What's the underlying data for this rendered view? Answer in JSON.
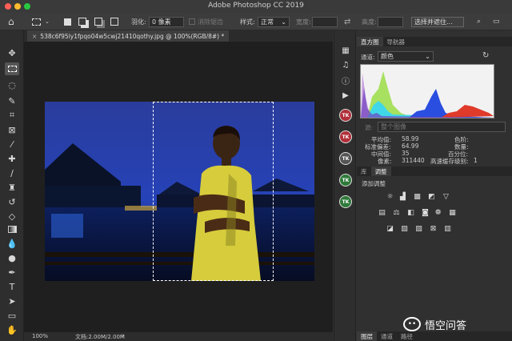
{
  "window": {
    "title": "Adobe Photoshop CC 2019"
  },
  "options_bar": {
    "feather_label": "羽化:",
    "feather_value": "0 像素",
    "antialias_label": "消除锯齿",
    "style_label": "样式:",
    "style_value": "正常",
    "width_label": "宽度:",
    "height_label": "高度:",
    "select_mask_button": "选择并遮住..."
  },
  "document": {
    "tab_title": "538c6f95ly1fpqo04w5cwj21410qothy.jpg @ 100%(RGB/8#) *",
    "zoom": "100%",
    "doc_size": "文档:2.00M/2.00M"
  },
  "histogram_panel": {
    "tabs": [
      "直方图",
      "导航器"
    ],
    "channel_label": "通道:",
    "channel_value": "颜色",
    "source_label": "源:",
    "source_value": "整个图像",
    "stats": {
      "mean_label": "平均值:",
      "mean": "58.99",
      "std_label": "标准偏差:",
      "std": "64.99",
      "median_label": "中间值:",
      "median": "35",
      "pixels_label": "像素:",
      "pixels": "311440",
      "level_label": "色阶:",
      "count_label": "数量:",
      "percentile_label": "百分位:",
      "cache_label": "高速缓存级别:",
      "cache": "1"
    }
  },
  "adjustments_panel": {
    "tabs": [
      "库",
      "调整"
    ],
    "title": "添加调整"
  },
  "layers_panel": {
    "tabs": [
      "图层",
      "通道",
      "路径"
    ]
  },
  "watermark": {
    "text": "悟空问答"
  },
  "tk_label": "TK",
  "colors": {
    "accent": "#2f6fd6",
    "tk_red": "#b0303a",
    "tk_green": "#2f7a3a"
  }
}
